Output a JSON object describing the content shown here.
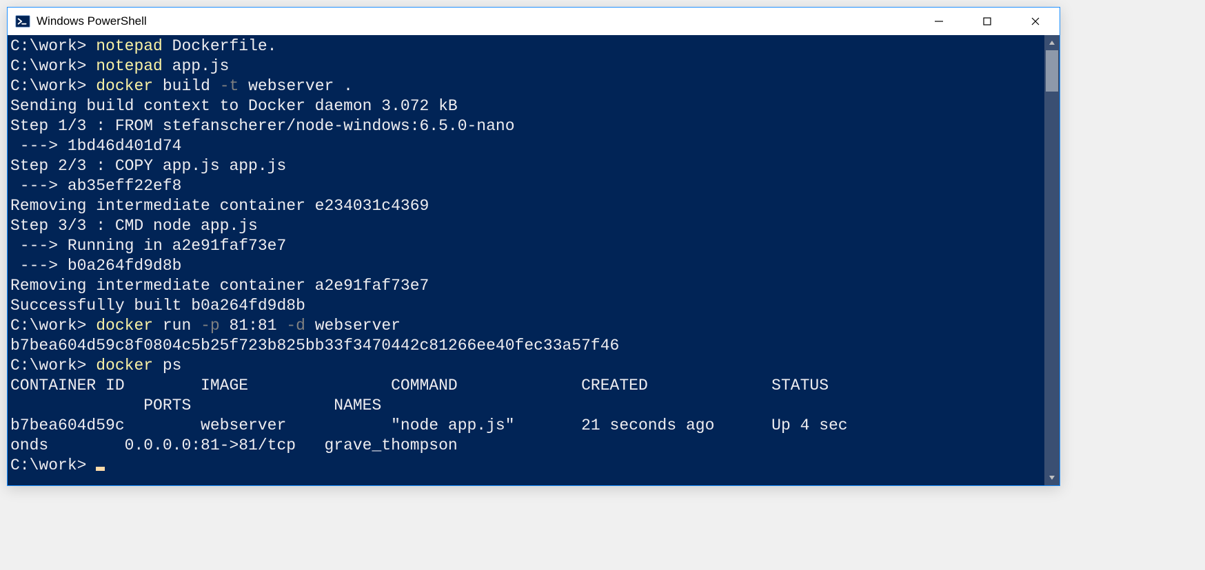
{
  "window": {
    "title": "Windows PowerShell"
  },
  "terminal": {
    "prompt": "C:\\work>",
    "lines": [
      {
        "type": "cmd",
        "prompt": "C:\\work> ",
        "parts": [
          {
            "cls": "cmd-yellow",
            "text": "notepad "
          },
          {
            "cls": "cmd-white",
            "text": "Dockerfile."
          }
        ]
      },
      {
        "type": "cmd",
        "prompt": "C:\\work> ",
        "parts": [
          {
            "cls": "cmd-yellow",
            "text": "notepad "
          },
          {
            "cls": "cmd-white",
            "text": "app.js"
          }
        ]
      },
      {
        "type": "cmd",
        "prompt": "C:\\work> ",
        "parts": [
          {
            "cls": "cmd-yellow",
            "text": "docker "
          },
          {
            "cls": "cmd-white",
            "text": "build "
          },
          {
            "cls": "cmd-gray",
            "text": "-t "
          },
          {
            "cls": "cmd-white",
            "text": "webserver ."
          }
        ]
      },
      {
        "type": "out",
        "text": "Sending build context to Docker daemon 3.072 kB"
      },
      {
        "type": "out",
        "text": "Step 1/3 : FROM stefanscherer/node-windows:6.5.0-nano"
      },
      {
        "type": "out",
        "text": " ---> 1bd46d401d74"
      },
      {
        "type": "out",
        "text": "Step 2/3 : COPY app.js app.js"
      },
      {
        "type": "out",
        "text": " ---> ab35eff22ef8"
      },
      {
        "type": "out",
        "text": "Removing intermediate container e234031c4369"
      },
      {
        "type": "out",
        "text": "Step 3/3 : CMD node app.js"
      },
      {
        "type": "out",
        "text": " ---> Running in a2e91faf73e7"
      },
      {
        "type": "out",
        "text": " ---> b0a264fd9d8b"
      },
      {
        "type": "out",
        "text": "Removing intermediate container a2e91faf73e7"
      },
      {
        "type": "out",
        "text": "Successfully built b0a264fd9d8b"
      },
      {
        "type": "cmd",
        "prompt": "C:\\work> ",
        "parts": [
          {
            "cls": "cmd-yellow",
            "text": "docker "
          },
          {
            "cls": "cmd-white",
            "text": "run "
          },
          {
            "cls": "cmd-gray",
            "text": "-p "
          },
          {
            "cls": "cmd-white",
            "text": "81:81 "
          },
          {
            "cls": "cmd-gray",
            "text": "-d "
          },
          {
            "cls": "cmd-white",
            "text": "webserver"
          }
        ]
      },
      {
        "type": "out",
        "text": "b7bea604d59c8f0804c5b25f723b825bb33f3470442c81266ee40fec33a57f46"
      },
      {
        "type": "cmd",
        "prompt": "C:\\work> ",
        "parts": [
          {
            "cls": "cmd-yellow",
            "text": "docker "
          },
          {
            "cls": "cmd-white",
            "text": "ps"
          }
        ]
      },
      {
        "type": "out",
        "text": "CONTAINER ID        IMAGE               COMMAND             CREATED             STATUS"
      },
      {
        "type": "out",
        "text": "              PORTS               NAMES"
      },
      {
        "type": "out",
        "text": "b7bea604d59c        webserver           \"node app.js\"       21 seconds ago      Up 4 sec"
      },
      {
        "type": "out",
        "text": "onds        0.0.0.0:81->81/tcp   grave_thompson"
      },
      {
        "type": "cmd",
        "prompt": "C:\\work> ",
        "parts": [],
        "cursor": true
      }
    ]
  }
}
